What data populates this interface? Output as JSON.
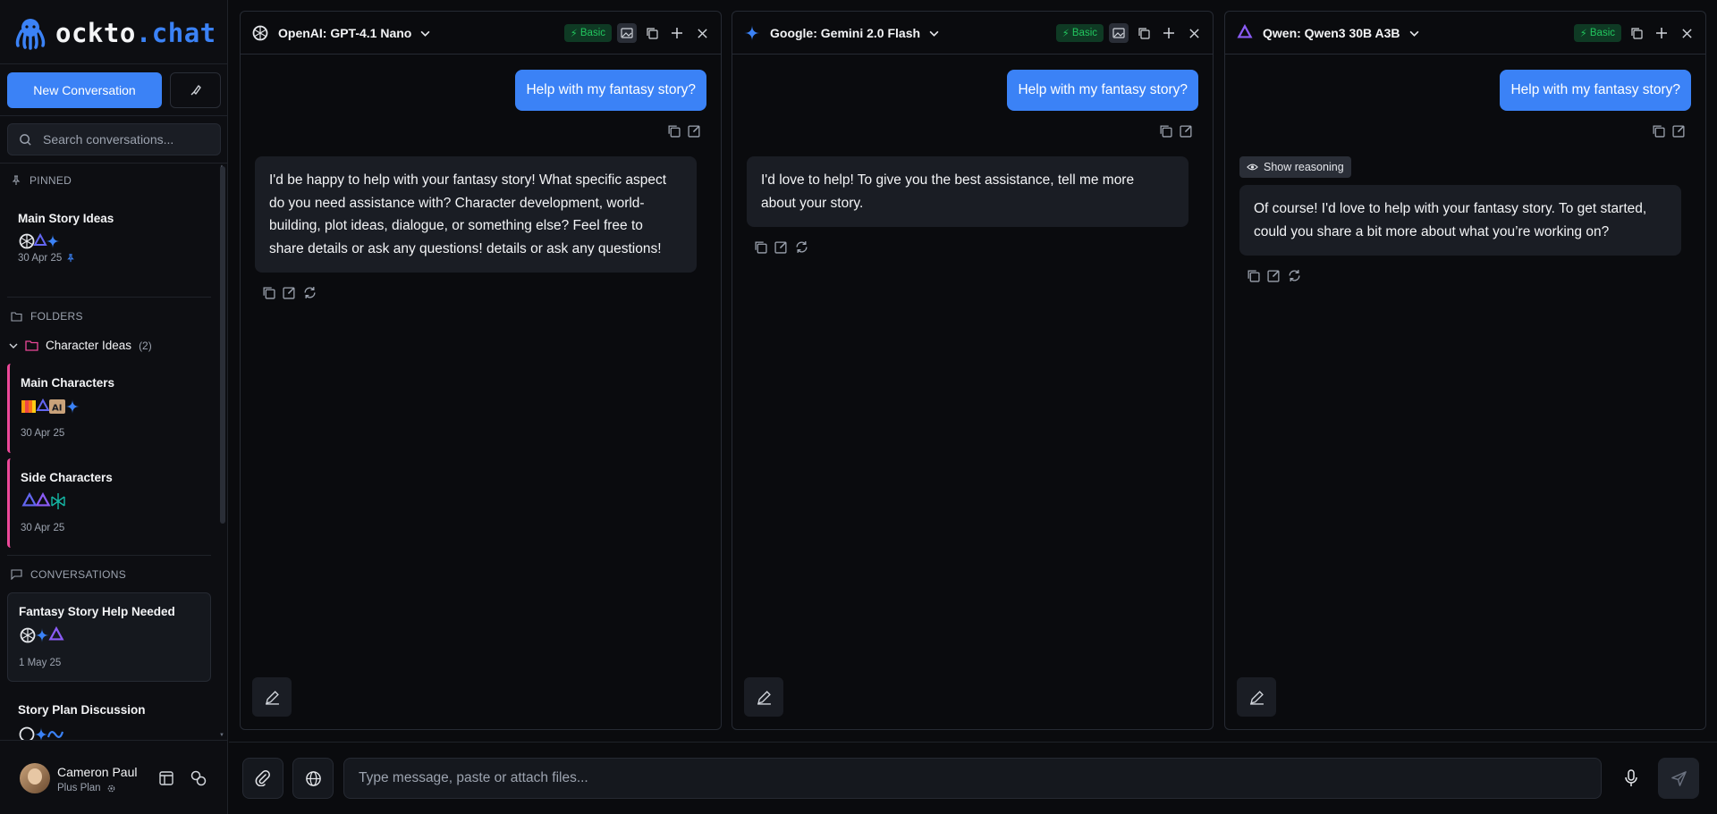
{
  "app": {
    "logo_a": "ockto",
    "logo_dot": ".",
    "logo_b": "chat"
  },
  "sidebar": {
    "new_conversation": "New Conversation",
    "search_placeholder": "Search conversations...",
    "pinned_label": "PINNED",
    "pinned": [
      {
        "title": "Main Story Ideas",
        "date": "30 Apr 25"
      }
    ],
    "folders_label": "FOLDERS",
    "folder": {
      "name": "Character Ideas",
      "count": "(2)"
    },
    "folder_items": [
      {
        "title": "Main Characters",
        "date": "30 Apr 25"
      },
      {
        "title": "Side Characters",
        "date": "30 Apr 25"
      }
    ],
    "conversations_label": "CONVERSATIONS",
    "conversations": [
      {
        "title": "Fantasy Story Help Needed",
        "date": "1 May 25"
      },
      {
        "title": "Story Plan Discussion",
        "date": ""
      }
    ]
  },
  "user": {
    "name": "Cameron Paul",
    "plan": "Plus Plan"
  },
  "panels": [
    {
      "model": "OpenAI: GPT-4.1 Nano",
      "badge": "Basic",
      "user_message": "Help with my fantasy story?",
      "reasoning_label": "",
      "ai_lines": [
        "I'd be happy to help with your fantasy story! What specific aspect",
        "do you need assistance with? Character development, world-",
        "building, plot ideas, dialogue, or something else? Feel free to",
        "share details or ask any questions! details or ask any questions!"
      ]
    },
    {
      "model": "Google: Gemini 2.0 Flash",
      "badge": "Basic",
      "user_message": "Help with my fantasy story?",
      "reasoning_label": "",
      "ai_lines": [
        "I'd love to help! To give you the best assistance, tell me more",
        "about your story."
      ]
    },
    {
      "model": "Qwen: Qwen3 30B A3B",
      "badge": "Basic",
      "user_message": "Help with my fantasy story?",
      "reasoning_label": "Show reasoning",
      "ai_lines": [
        "Of course! I'd love to help with your fantasy story. To get started,",
        "could you share a bit more about what you’re working on?"
      ]
    }
  ],
  "composer": {
    "placeholder": "Type message, paste or attach files..."
  },
  "colors": {
    "accent": "#3b82f6",
    "badge_green": "#22c55e",
    "folder_pink": "#ec4899",
    "bg": "#0a0b0e"
  }
}
